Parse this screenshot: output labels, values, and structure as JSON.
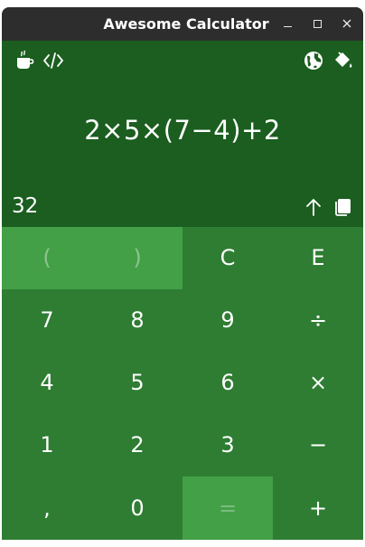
{
  "window": {
    "title": "Awesome Calculator"
  },
  "display": {
    "expression": "2×5×(7−4)+2",
    "result": "32"
  },
  "icons": {
    "coffee": "coffee-icon",
    "code": "code-icon",
    "globe": "globe-icon",
    "theme": "paint-bucket-icon",
    "up": "arrow-up-icon",
    "copy": "copy-icon"
  },
  "keys": {
    "open_paren": "(",
    "close_paren": ")",
    "clear": "C",
    "e": "E",
    "k7": "7",
    "k8": "8",
    "k9": "9",
    "divide": "÷",
    "k4": "4",
    "k5": "5",
    "k6": "6",
    "multiply": "×",
    "k1": "1",
    "k2": "2",
    "k3": "3",
    "minus": "−",
    "comma": ",",
    "k0": "0",
    "equals": "=",
    "plus": "+"
  },
  "colors": {
    "titlebar": "#2d2d2d",
    "display_bg": "#1b5e20",
    "keypad_bg": "#2e7d32",
    "highlight_key": "#43a047"
  }
}
